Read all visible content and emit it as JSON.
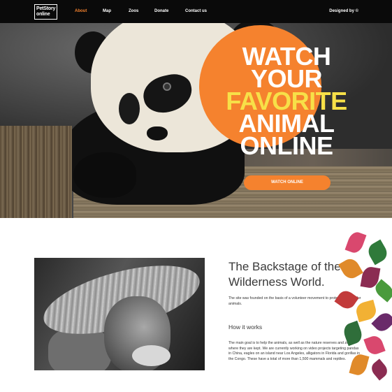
{
  "nav": {
    "logo_line1": "PetStory",
    "logo_line2": "online",
    "items": [
      {
        "label": "About",
        "active": true
      },
      {
        "label": "Map",
        "active": false
      },
      {
        "label": "Zoos",
        "active": false
      },
      {
        "label": "Donate",
        "active": false
      },
      {
        "label": "Contact us",
        "active": false
      }
    ],
    "designed_by": "Designed by ©"
  },
  "hero": {
    "headline": [
      "WATCH",
      "YOUR",
      "FAVORITE",
      "ANIMAL",
      "ONLINE"
    ],
    "cta_label": "WATCH ONLINE"
  },
  "content": {
    "title": "The Backstage of the Wilderness World.",
    "intro": "The site was founded on the basis of a volunteer movement to protect and care for animals.",
    "subtitle": "How it works",
    "body": "The main goal is to help the animals, as well as the nature reserves and zoos where they are kept. We are currently working on video projects targeting pandas in China, eagles on an island near Los Angeles, alligators in Florida and gorillas in the Congo. These have a total of more than 1,500 mammals and reptiles."
  },
  "colors": {
    "accent": "#f5822e",
    "highlight": "#f7e048",
    "nav_bg": "#0a0a0a"
  }
}
